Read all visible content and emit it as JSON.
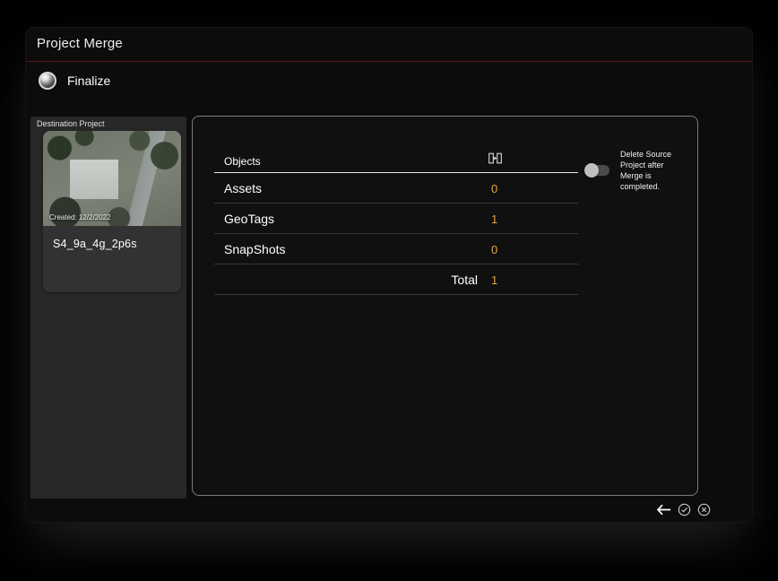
{
  "colors": {
    "accent_orange": "#e8a33b",
    "divider_red": "#5d1717",
    "panel_gray": "#282828"
  },
  "window": {
    "title": "Project Merge"
  },
  "steps": {
    "finalize_label": "Finalize"
  },
  "destination": {
    "panel_label": "Destination Project",
    "created": "Created: 12/2/2022",
    "project_name": "S4_9a_4g_2p6s"
  },
  "table": {
    "header": "Objects",
    "header_icon": "merge-columns-icon",
    "rows": [
      {
        "label": "Assets",
        "value": "0"
      },
      {
        "label": "GeoTags",
        "value": "1"
      },
      {
        "label": "SnapShots",
        "value": "0"
      }
    ],
    "total_label": "Total",
    "total_value": "1"
  },
  "options": {
    "delete_source_label": "Delete Source Project after Merge is completed.",
    "toggle_state": "off"
  },
  "icons": {
    "finalize": "sphere-icon",
    "objects_header": "merge-columns-icon",
    "back": "back-arrow-icon",
    "confirm": "confirm-circle-icon",
    "cancel": "cancel-circle-icon"
  }
}
